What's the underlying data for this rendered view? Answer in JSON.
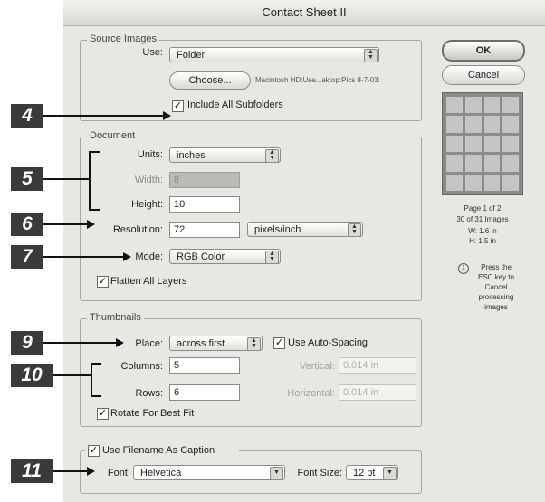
{
  "window": {
    "title": "Contact Sheet II"
  },
  "source_images": {
    "group_label": "Source Images",
    "use_label": "Use:",
    "use_value": "Folder",
    "choose_button": "Choose...",
    "path": "Macintosh HD:Use...aktop:Pics 8-7-03:",
    "include_subfolders_label": "Include All Subfolders",
    "include_subfolders_checked": true
  },
  "document": {
    "group_label": "Document",
    "units_label": "Units:",
    "units_value": "inches",
    "width_label": "Width:",
    "width_value": "8",
    "height_label": "Height:",
    "height_value": "10",
    "resolution_label": "Resolution:",
    "resolution_value": "72",
    "resolution_unit": "pixels/inch",
    "mode_label": "Mode:",
    "mode_value": "RGB Color",
    "flatten_label": "Flatten All Layers",
    "flatten_checked": true
  },
  "thumbnails": {
    "group_label": "Thumbnails",
    "place_label": "Place:",
    "place_value": "across first",
    "auto_spacing_label": "Use Auto-Spacing",
    "auto_spacing_checked": true,
    "columns_label": "Columns:",
    "columns_value": "5",
    "rows_label": "Rows:",
    "rows_value": "6",
    "vertical_label": "Vertical:",
    "vertical_value": "0.014 in",
    "horizontal_label": "Horizontal:",
    "horizontal_value": "0.014 in",
    "rotate_label": "Rotate For Best Fit",
    "rotate_checked": true
  },
  "caption": {
    "use_filename_label": "Use Filename As Caption",
    "use_filename_checked": true,
    "font_label": "Font:",
    "font_value": "Helvetica",
    "font_size_label": "Font Size:",
    "font_size_value": "12 pt"
  },
  "buttons": {
    "ok": "OK",
    "cancel": "Cancel"
  },
  "preview": {
    "page": "Page 1 of 2",
    "images": "30 of 31 Images",
    "w": "W: 1.6 in",
    "h": "H: 1.5 in",
    "hint_icon": "info-circle-icon",
    "hint_lines": [
      "Press the",
      "ESC key to",
      "Cancel",
      "processing",
      "images"
    ]
  },
  "callouts": [
    "4",
    "5",
    "6",
    "7",
    "9",
    "10",
    "11"
  ],
  "colors": {
    "callout_bg": "#3a3a3a",
    "dialog_bg": "#e9e7e1"
  }
}
